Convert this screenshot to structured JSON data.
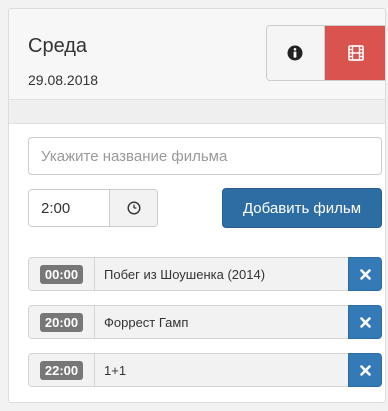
{
  "header": {
    "day": "Среда",
    "date": "29.08.2018",
    "info_icon": "info-circle-icon",
    "film_icon": "film-icon",
    "accent_color": "#d9534f"
  },
  "form": {
    "film_placeholder": "Укажите название фильма",
    "film_value": "",
    "time_value": "2:00",
    "clock_icon": "clock-icon",
    "add_button_label": "Добавить фильм",
    "add_button_color": "#2e6da4"
  },
  "schedule": [
    {
      "time": "00:00",
      "title": "Побег из Шоушенка (2014)",
      "delete_icon": "close-icon"
    },
    {
      "time": "20:00",
      "title": "Форрест Гамп",
      "delete_icon": "close-icon"
    },
    {
      "time": "22:00",
      "title": "1+1",
      "delete_icon": "close-icon"
    }
  ]
}
